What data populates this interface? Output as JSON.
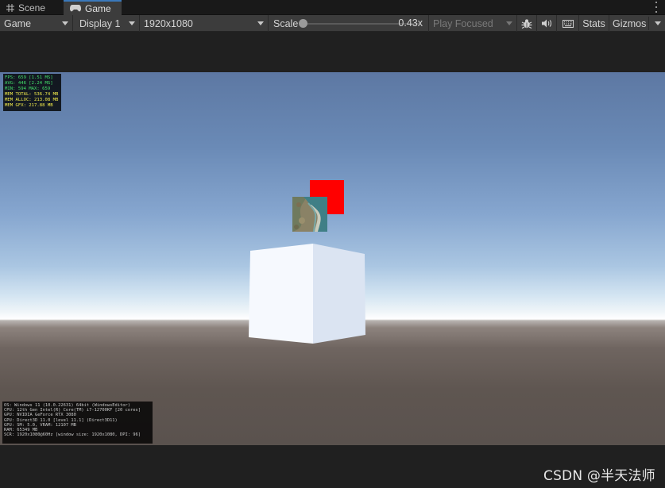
{
  "tabs": {
    "scene_label": "Scene",
    "game_label": "Game"
  },
  "toolbar": {
    "view_select": "Game",
    "display_select": "Display 1",
    "resolution_select": "1920x1080",
    "scale_label": "Scale",
    "scale_value": "0.43x",
    "scale_slider_fraction": 0.0,
    "play_mode_select": "Play Focused",
    "stats_label": "Stats",
    "gizmos_label": "Gizmos",
    "icons": [
      "bug-icon",
      "audio-icon",
      "keyboard-icon",
      "caret-down-icon",
      "more-vert-icon"
    ]
  },
  "overlay_fps": {
    "line1": "FPS: 659 [1.51 MS]",
    "line2": "AVG: 446 [2.24 MS]",
    "line3": "MIN: 594 MAX: 659",
    "line4": "MEM TOTAL: 536.74 MB",
    "line5": "MEM ALLOC: 213.08 MB",
    "line6": "MEM GFX: 217.88 MB"
  },
  "overlay_sysinfo": {
    "line1": "OS: Windows 11  (10.0.22631) 64bit (WindowsEditor)",
    "line2": "CPU: 12th Gen Intel(R) Core(TM) i7-12700KF [20 cores]",
    "line3": "GPU: NVIDIA GeForce RTX 3080",
    "line4": "GPU: Direct3D 11.0 [level 11.1] (Direct3D11)",
    "line5": "GPU: SM: 5.0, VRAM: 12107 MB",
    "line6": "RAM: 65349 MB",
    "line7": "SCR: 1920x1080@60Hz [window size: 1920x1080, DPI: 96]"
  },
  "colors": {
    "red_square": "#ff0000",
    "tab_accent": "#3a79bb",
    "fps_green": "#43e06a",
    "mem_yellow": "#f3ec4b"
  },
  "watermark": "CSDN @半天法师"
}
